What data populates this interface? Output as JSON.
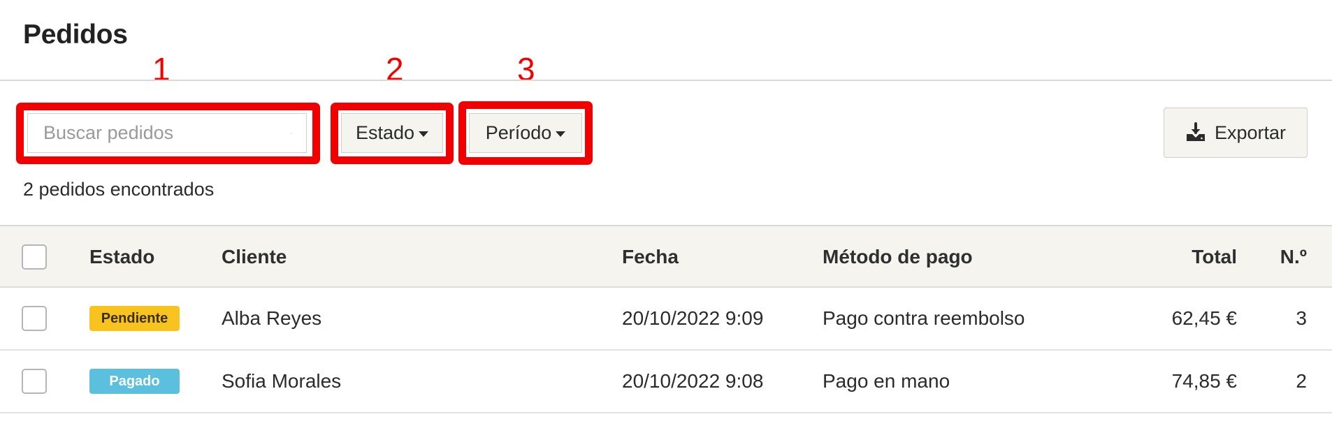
{
  "page": {
    "title": "Pedidos"
  },
  "callouts": [
    "1",
    "2",
    "3"
  ],
  "toolbar": {
    "search": {
      "placeholder": "Buscar pedidos",
      "value": "",
      "icon": "search-icon"
    },
    "status_filter": {
      "label": "Estado",
      "icon": "caret-down-icon"
    },
    "period_filter": {
      "label": "Período",
      "icon": "caret-down-icon"
    },
    "export": {
      "label": "Exportar",
      "icon": "download-icon"
    }
  },
  "result_count": "2 pedidos encontrados",
  "table": {
    "columns": [
      "Estado",
      "Cliente",
      "Fecha",
      "Método de pago",
      "Total",
      "N.º"
    ],
    "rows": [
      {
        "status": "Pendiente",
        "status_color": "#f9c31f",
        "customer": "Alba Reyes",
        "date": "20/10/2022 9:09",
        "payment_method": "Pago contra reembolso",
        "total": "62,45 €",
        "number": "3",
        "checked": false
      },
      {
        "status": "Pagado",
        "status_color": "#5bc0de",
        "customer": "Sofia Morales",
        "date": "20/10/2022 9:08",
        "payment_method": "Pago en mano",
        "total": "74,85 €",
        "number": "2",
        "checked": false
      }
    ]
  },
  "colors": {
    "callout_red": "#f20000",
    "header_bg": "#f5f4ef",
    "pending_badge": "#f9c31f",
    "paid_badge": "#5bc0de"
  }
}
